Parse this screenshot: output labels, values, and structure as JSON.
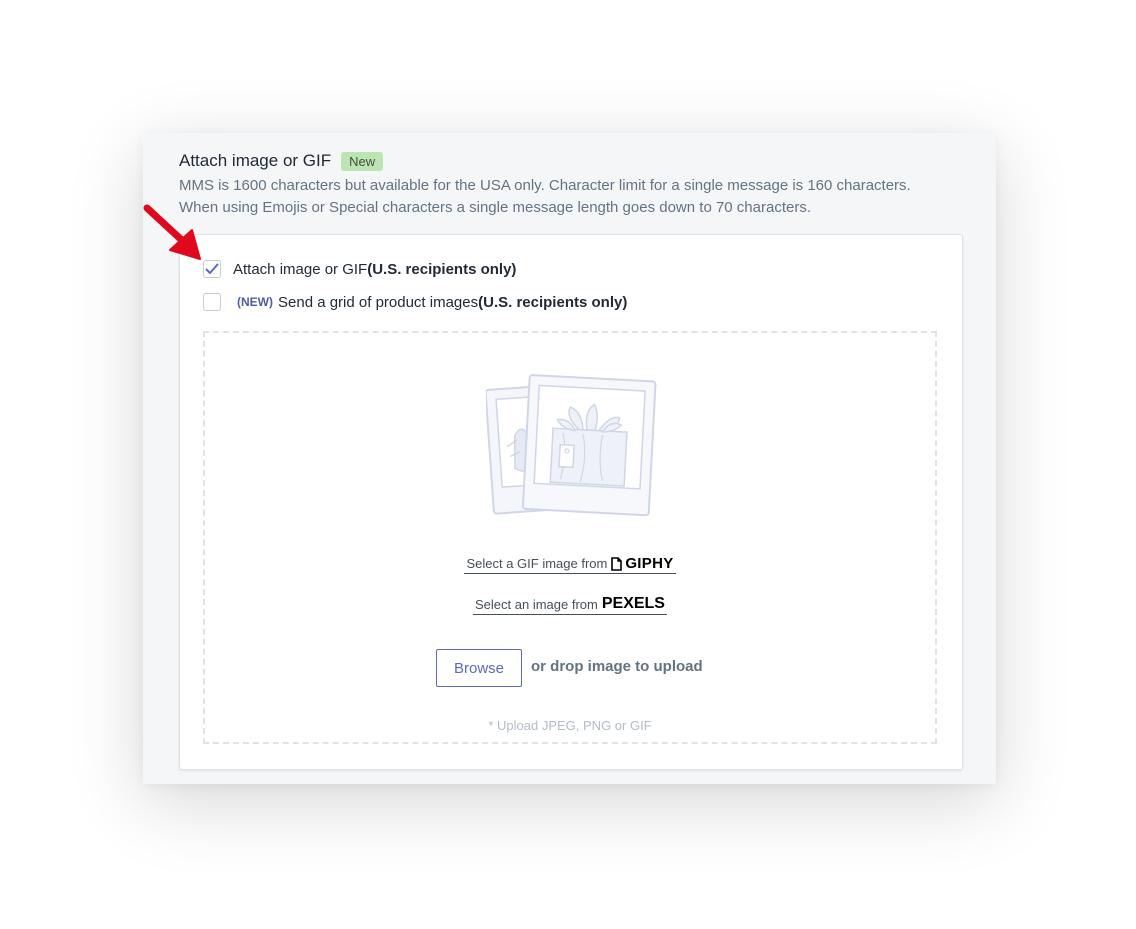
{
  "section": {
    "title": "Attach image or GIF",
    "badge": "New",
    "description_line1": "MMS is 1600 characters but available for the USA only. Character limit for a single message is 160 characters.",
    "description_line2": "When using Emojis or Special characters a single message length goes down to 70 characters."
  },
  "options": [
    {
      "label": "Attach image or GIF ",
      "emphasis": "(U.S. recipients only)",
      "checked": true
    },
    {
      "tag": "(NEW)",
      "label": "Send a grid of product images ",
      "emphasis": "(U.S. recipients only)",
      "checked": false
    }
  ],
  "dropzone": {
    "illustration_icon": "photo-stack-illustration",
    "giphy_link_label": "Select a GIF image from",
    "giphy_brand": "GIPHY",
    "pexels_link_label": "Select an image from",
    "pexels_brand": "PEXELS",
    "browse_label": "Browse",
    "drop_text": "or drop image to upload",
    "hint": "* Upload JPEG, PNG or GIF"
  },
  "colors": {
    "accent": "#5c6ac4",
    "badge_bg": "#bbe5b3",
    "annotation_arrow": "#e0081c"
  },
  "annotation": {
    "icon": "red-arrow-icon"
  }
}
